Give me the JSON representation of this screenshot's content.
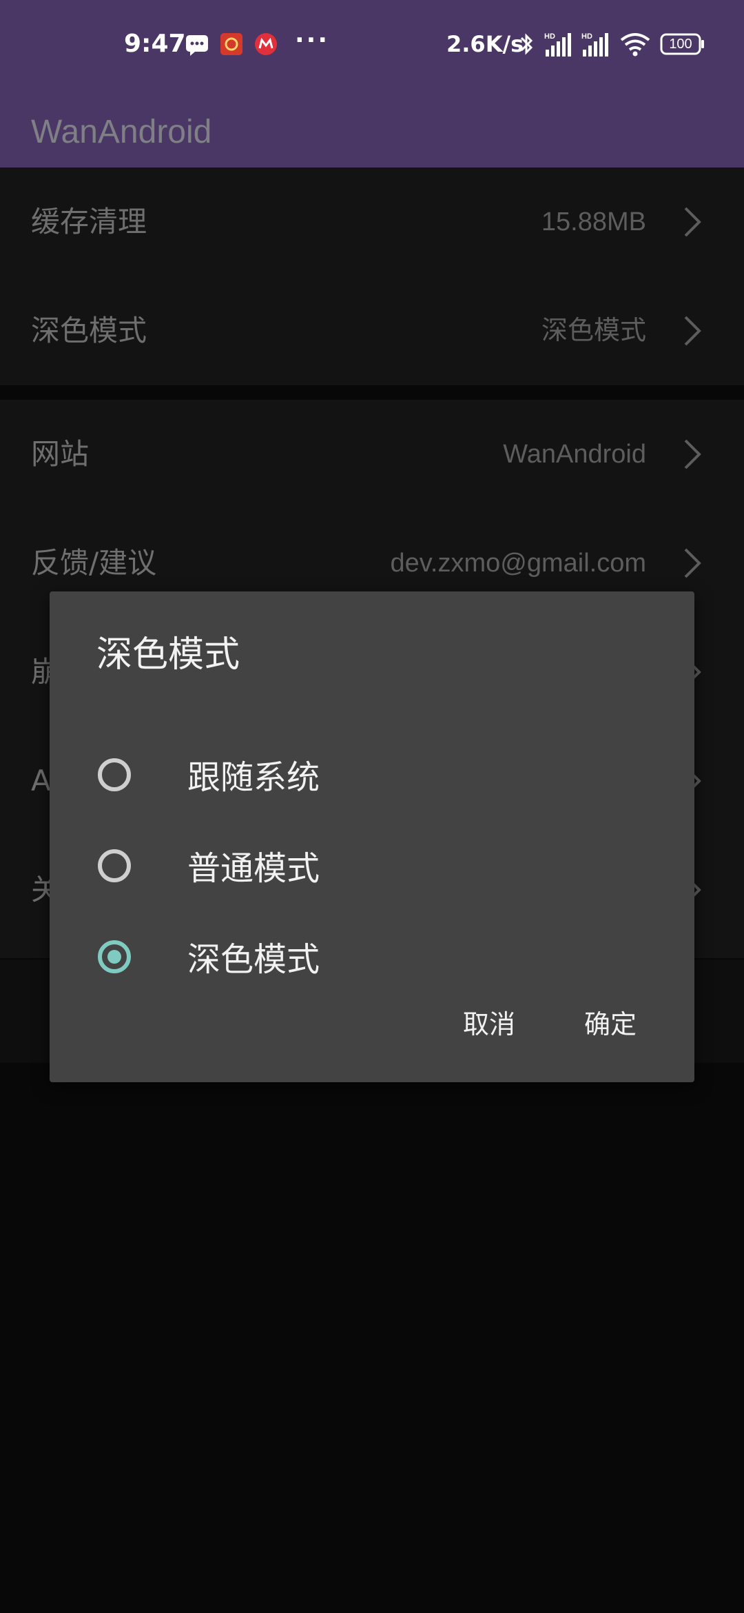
{
  "status_bar": {
    "time": "9:47",
    "speed": "2.6K/s",
    "battery": "100",
    "icons": [
      "message-icon",
      "app-badge-icon",
      "metro-icon",
      "more-dots-icon",
      "bluetooth-icon",
      "signal-hd-icon",
      "signal-hd-icon",
      "wifi-icon",
      "battery-icon"
    ]
  },
  "app_bar": {
    "title": "WanAndroid"
  },
  "settings": {
    "group1": [
      {
        "label": "缓存清理",
        "value": "15.88MB"
      },
      {
        "label": "深色模式",
        "value": "深色模式"
      }
    ],
    "group2": [
      {
        "label": "网站",
        "value": "WanAndroid"
      },
      {
        "label": "反馈/建议",
        "value": "dev.zxmo@gmail.com"
      },
      {
        "label": "崩",
        "value": ""
      },
      {
        "label": "A",
        "value": ""
      },
      {
        "label": "关",
        "value": ""
      }
    ]
  },
  "dialog": {
    "title": "深色模式",
    "options": [
      {
        "label": "跟随系统",
        "checked": false
      },
      {
        "label": "普通模式",
        "checked": false
      },
      {
        "label": "深色模式",
        "checked": true
      }
    ],
    "cancel_label": "取消",
    "ok_label": "确定"
  },
  "colors": {
    "primary": "#4a3765",
    "accent": "#7fcbc2",
    "dialog_bg": "#434343"
  }
}
